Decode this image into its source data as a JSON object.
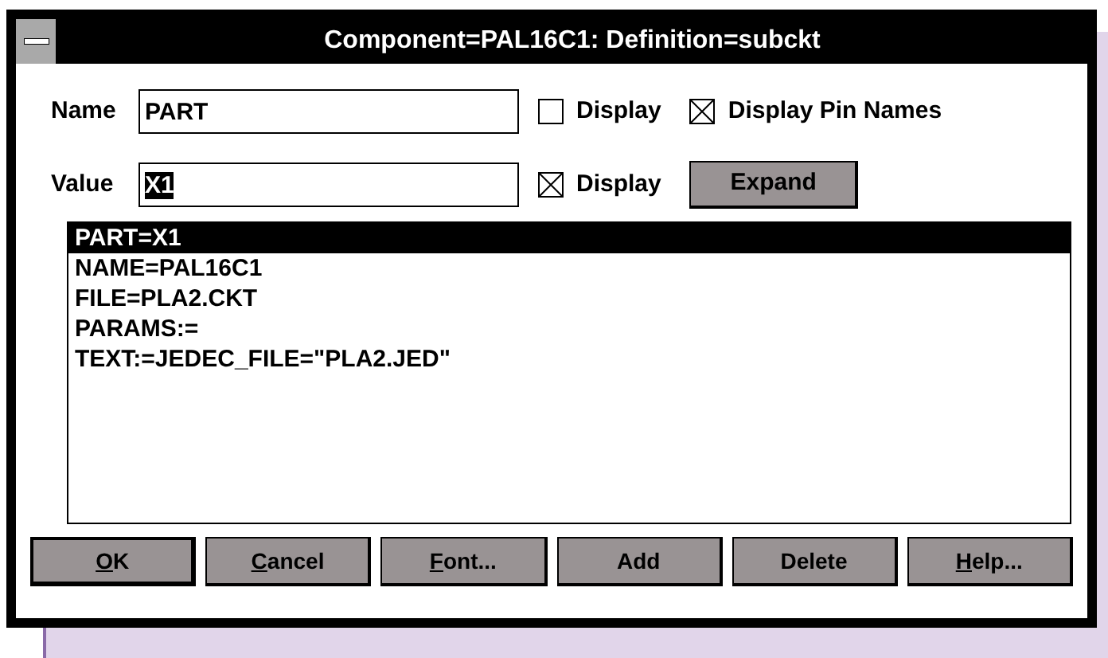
{
  "window": {
    "title": "Component=PAL16C1: Definition=subckt"
  },
  "name_field": {
    "label": "Name",
    "value": "PART",
    "value_selected": false
  },
  "name_display": {
    "label": "Display",
    "checked": false
  },
  "pin_names": {
    "label": "Display Pin Names",
    "checked": true
  },
  "value_field": {
    "label": "Value",
    "value": "X1",
    "value_selected": true
  },
  "value_display": {
    "label": "Display",
    "checked": true
  },
  "expand_button": "Expand",
  "attributes": [
    {
      "text": "PART=X1",
      "selected": true
    },
    {
      "text": "NAME=PAL16C1",
      "selected": false
    },
    {
      "text": "FILE=PLA2.CKT",
      "selected": false
    },
    {
      "text": "PARAMS:=",
      "selected": false
    },
    {
      "text": "TEXT:=JEDEC_FILE=\"PLA2.JED\"",
      "selected": false
    }
  ],
  "buttons": [
    {
      "label": "OK",
      "underline_first": true,
      "default": true
    },
    {
      "label": "Cancel",
      "underline_first": true,
      "default": false
    },
    {
      "label": "Font...",
      "underline_first": true,
      "default": false
    },
    {
      "label": "Add",
      "underline_first": false,
      "default": false
    },
    {
      "label": "Delete",
      "underline_first": false,
      "default": false
    },
    {
      "label": "Help...",
      "underline_first": true,
      "default": false
    }
  ]
}
